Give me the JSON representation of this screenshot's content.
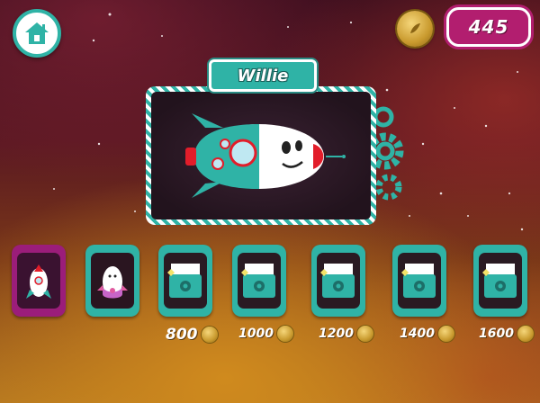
{
  "hud": {
    "home_icon": "home-icon",
    "coin_icon": "coin-icon",
    "coin_balance": "445"
  },
  "selected_rocket": {
    "name": "Willie"
  },
  "skins": [
    {
      "id": "willie",
      "state": "selected",
      "price": ""
    },
    {
      "id": "pink-rocket",
      "state": "owned",
      "price": ""
    },
    {
      "id": "locked-1",
      "state": "locked",
      "price": "800"
    },
    {
      "id": "locked-2",
      "state": "locked",
      "price": "1000"
    },
    {
      "id": "locked-3",
      "state": "locked",
      "price": "1200"
    },
    {
      "id": "locked-4",
      "state": "locked",
      "price": "1400"
    },
    {
      "id": "locked-5",
      "state": "locked",
      "price": "1600"
    }
  ],
  "colors": {
    "teal": "#2fb3a6",
    "magenta": "#b21e6f",
    "selected": "#9b1d7a",
    "gold": "#c99a2e"
  }
}
